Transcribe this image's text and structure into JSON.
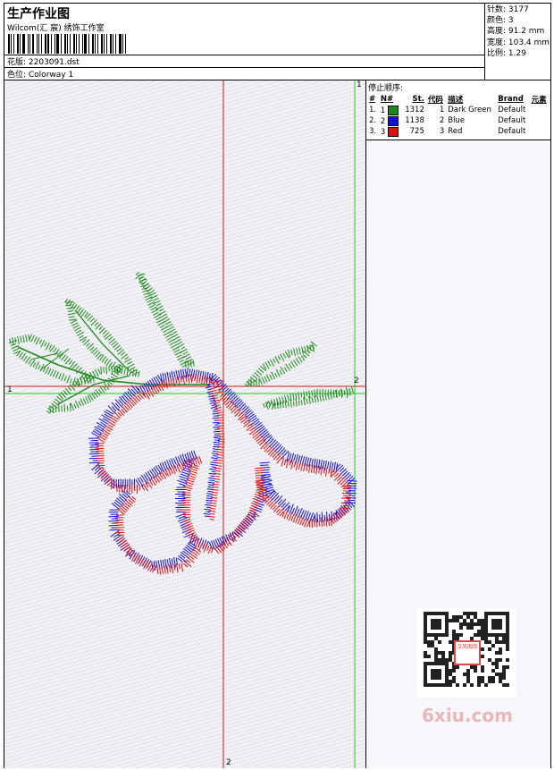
{
  "header": {
    "title": "生产作业图",
    "subtitle": "Wilcom(汇 宸) 绣饰工作室",
    "design_line": "花版: 2203091.dst",
    "colorway_line": "色位: Colorway 1"
  },
  "stats": {
    "stitches": "针数: 3177",
    "colors": "颜色: 3",
    "height": "高度: 91.2 mm",
    "width": "宽度: 103.4 mm",
    "scale": "比例: 1.29"
  },
  "sequence": {
    "title": "停止顺序:",
    "headers": [
      "#",
      "N#",
      "St.",
      "代码",
      "描述",
      "Brand",
      "元素"
    ],
    "rows": [
      {
        "num": "1.",
        "n": "1",
        "color": "#1a8a1a",
        "st": "1312",
        "code": "1",
        "desc": "Dark Green",
        "brand": "Default",
        "element": ""
      },
      {
        "num": "2.",
        "n": "2",
        "color": "#1010d8",
        "st": "1138",
        "code": "2",
        "desc": "Blue",
        "brand": "Default",
        "element": ""
      },
      {
        "num": "3.",
        "n": "3",
        "color": "#e01010",
        "st": "725",
        "code": "3",
        "desc": "Red",
        "brand": "Default",
        "element": ""
      }
    ]
  },
  "guides": {
    "top_right": "1",
    "left": "1",
    "right": "2",
    "bottom": "2"
  },
  "watermark": {
    "stamp": "汉风图库",
    "site": "6xiu.com"
  },
  "colors": {
    "green": "#1a8a1a",
    "blue": "#1010d8",
    "red": "#e01010",
    "guide_red": "#d81818",
    "guide_green": "#22cc22"
  }
}
